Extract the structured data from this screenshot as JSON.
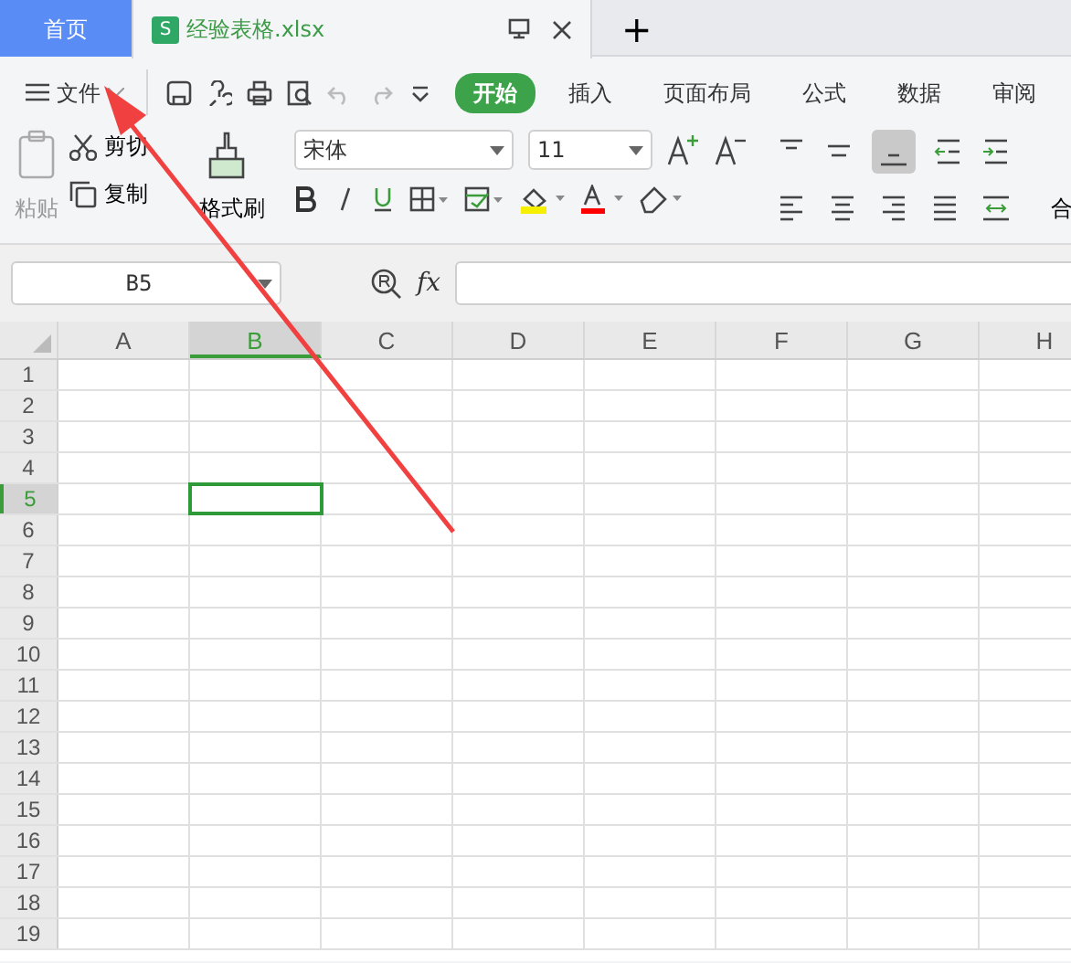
{
  "tabs": [
    {
      "label": "首页",
      "kind": "home",
      "selected": false
    },
    {
      "label": "经验表格.xlsx",
      "kind": "document",
      "icon_letter": "S",
      "selected": true
    }
  ],
  "new_tab": "+",
  "file_menu": {
    "label": "文件"
  },
  "ribbon_tabs": [
    {
      "label": "开始",
      "selected": true
    },
    {
      "label": "插入",
      "selected": false
    },
    {
      "label": "页面布局",
      "selected": false
    },
    {
      "label": "公式",
      "selected": false
    },
    {
      "label": "数据",
      "selected": false
    },
    {
      "label": "审阅",
      "selected": false
    }
  ],
  "clipboard": {
    "paste": "粘贴",
    "cut": "剪切",
    "copy": "复制",
    "format_painter": "格式刷"
  },
  "font": {
    "name": "宋体",
    "size": "11"
  },
  "alignment": {
    "merge": "合"
  },
  "name_box": {
    "value": "B5"
  },
  "formula_label": "fx",
  "grid": {
    "columns": [
      {
        "label": "A",
        "selected": false
      },
      {
        "label": "B",
        "selected": true
      },
      {
        "label": "C",
        "selected": false
      },
      {
        "label": "D",
        "selected": false
      },
      {
        "label": "E",
        "selected": false
      },
      {
        "label": "F",
        "selected": false
      },
      {
        "label": "G",
        "selected": false
      },
      {
        "label": "H",
        "selected": false
      }
    ],
    "rows": [
      {
        "label": "1",
        "selected": false
      },
      {
        "label": "2",
        "selected": false
      },
      {
        "label": "3",
        "selected": false
      },
      {
        "label": "4",
        "selected": false
      },
      {
        "label": "5",
        "selected": true
      },
      {
        "label": "6",
        "selected": false
      },
      {
        "label": "7",
        "selected": false
      },
      {
        "label": "8",
        "selected": false
      },
      {
        "label": "9",
        "selected": false
      },
      {
        "label": "10",
        "selected": false
      },
      {
        "label": "11",
        "selected": false
      },
      {
        "label": "12",
        "selected": false
      },
      {
        "label": "13",
        "selected": false
      },
      {
        "label": "14",
        "selected": false
      },
      {
        "label": "15",
        "selected": false
      },
      {
        "label": "16",
        "selected": false
      },
      {
        "label": "17",
        "selected": false
      },
      {
        "label": "18",
        "selected": false
      },
      {
        "label": "19",
        "selected": false
      }
    ]
  }
}
